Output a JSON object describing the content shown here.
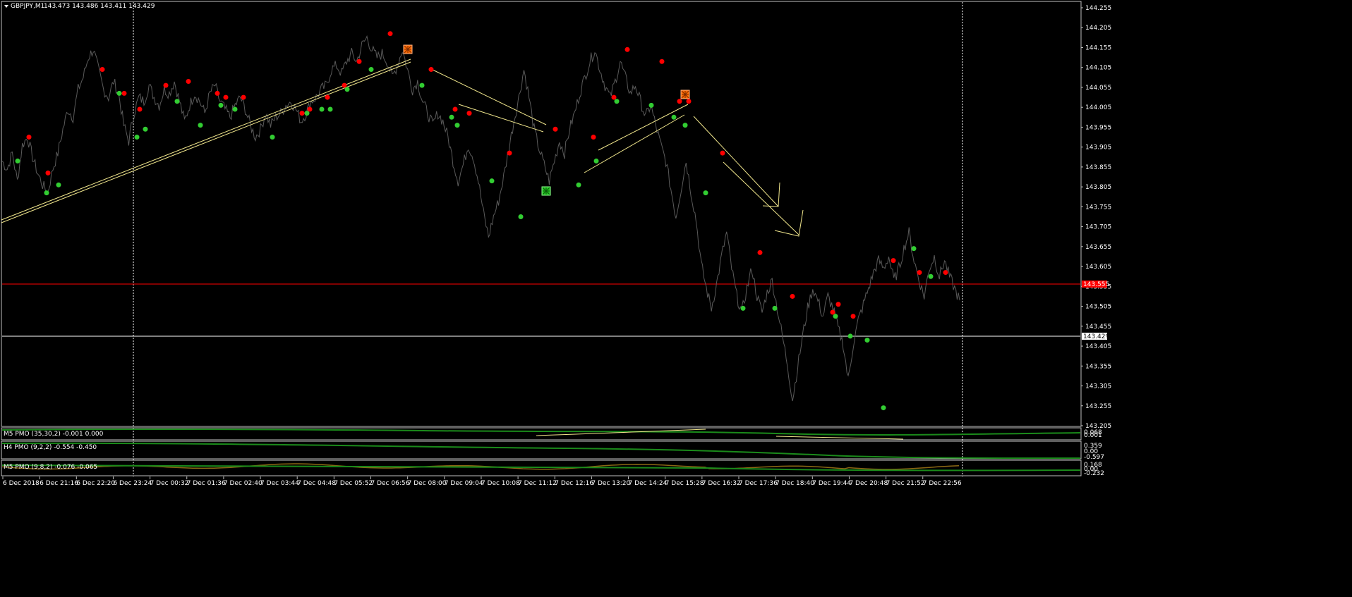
{
  "chart_header": {
    "symbol": "GBPJPY,M1",
    "ohlc": "143.473 143.486 143.411 143.429"
  },
  "chart_data": {
    "type": "line",
    "symbol": "GBPJPY",
    "timeframe": "M1",
    "price_axis": {
      "min": 143.205,
      "max": 144.255,
      "ticks": [
        "144.255",
        "144.205",
        "144.155",
        "144.105",
        "144.055",
        "144.005",
        "143.955",
        "143.905",
        "143.855",
        "143.805",
        "143.755",
        "143.705",
        "143.655",
        "143.605",
        "143.555",
        "143.505",
        "143.455",
        "143.405",
        "143.355",
        "143.305",
        "143.255",
        "143.205"
      ]
    },
    "time_axis": {
      "ticks": [
        "6 Dec 2018",
        "6 Dec 21:16",
        "6 Dec 22:20",
        "6 Dec 23:24",
        "7 Dec 00:32",
        "7 Dec 01:36",
        "7 Dec 02:40",
        "7 Dec 03:44",
        "7 Dec 04:48",
        "7 Dec 05:52",
        "7 Dec 06:56",
        "7 Dec 08:00",
        "7 Dec 09:04",
        "7 Dec 10:08",
        "7 Dec 11:12",
        "7 Dec 12:16",
        "7 Dec 13:20",
        "7 Dec 14:24",
        "7 Dec 15:28",
        "7 Dec 16:32",
        "7 Dec 17:36",
        "7 Dec 18:40",
        "7 Dec 19:44",
        "7 Dec 20:48",
        "7 Dec 21:52",
        "7 Dec 22:56"
      ]
    },
    "price_series": [
      [
        0,
        143.87
      ],
      [
        0.5,
        143.85
      ],
      [
        1,
        143.89
      ],
      [
        1.5,
        143.82
      ],
      [
        2,
        143.91
      ],
      [
        2.5,
        143.93
      ],
      [
        3,
        143.88
      ],
      [
        3.5,
        143.84
      ],
      [
        4,
        143.81
      ],
      [
        4.5,
        143.79
      ],
      [
        5,
        143.85
      ],
      [
        5.5,
        143.89
      ],
      [
        6,
        143.95
      ],
      [
        6.5,
        144.0
      ],
      [
        7,
        143.98
      ],
      [
        7.5,
        144.05
      ],
      [
        8,
        144.08
      ],
      [
        8.5,
        144.13
      ],
      [
        9,
        144.15
      ],
      [
        9.5,
        144.1
      ],
      [
        10,
        144.05
      ],
      [
        10.5,
        144.03
      ],
      [
        11,
        144.07
      ],
      [
        11.5,
        144.04
      ],
      [
        12,
        143.96
      ],
      [
        12.5,
        143.92
      ],
      [
        13,
        143.99
      ],
      [
        13.5,
        144.03
      ],
      [
        14,
        144.02
      ],
      [
        14.5,
        144.06
      ],
      [
        15,
        144.03
      ],
      [
        15.5,
        144.01
      ],
      [
        16,
        144.05
      ],
      [
        16.5,
        144.04
      ],
      [
        17,
        144.07
      ],
      [
        17.5,
        144.02
      ],
      [
        18,
        143.97
      ],
      [
        18.5,
        144.01
      ],
      [
        19,
        144.04
      ],
      [
        19.5,
        144.02
      ],
      [
        20,
        143.99
      ],
      [
        20.5,
        144.04
      ],
      [
        21,
        144.06
      ],
      [
        21.5,
        144.02
      ],
      [
        22,
        144.0
      ],
      [
        22.5,
        143.98
      ],
      [
        23,
        144.01
      ],
      [
        23.5,
        144.03
      ],
      [
        24,
        144.0
      ],
      [
        24.5,
        143.96
      ],
      [
        25,
        143.93
      ],
      [
        25.5,
        143.95
      ],
      [
        26,
        143.99
      ],
      [
        26.5,
        143.96
      ],
      [
        27,
        143.98
      ],
      [
        27.5,
        143.99
      ],
      [
        28,
        144.01
      ],
      [
        28.5,
        144.02
      ],
      [
        29,
        144.0
      ],
      [
        29.5,
        143.97
      ],
      [
        30,
        143.99
      ],
      [
        30.5,
        144.02
      ],
      [
        31,
        144.03
      ],
      [
        31.5,
        144.05
      ],
      [
        32,
        144.06
      ],
      [
        32.5,
        144.1
      ],
      [
        33,
        144.11
      ],
      [
        33.5,
        144.09
      ],
      [
        34,
        144.12
      ],
      [
        34.5,
        144.14
      ],
      [
        35,
        144.12
      ],
      [
        35.5,
        144.16
      ],
      [
        36,
        144.18
      ],
      [
        36.5,
        144.15
      ],
      [
        37,
        144.13
      ],
      [
        37.5,
        144.14
      ],
      [
        38,
        144.12
      ],
      [
        38.5,
        144.08
      ],
      [
        39,
        144.11
      ],
      [
        39.5,
        144.15
      ],
      [
        40,
        144.1
      ],
      [
        40.5,
        144.05
      ],
      [
        41,
        144.07
      ],
      [
        41.5,
        144.02
      ],
      [
        42,
        143.99
      ],
      [
        42.5,
        143.96
      ],
      [
        43,
        143.99
      ],
      [
        43.5,
        143.97
      ],
      [
        44,
        143.93
      ],
      [
        44.5,
        143.87
      ],
      [
        45,
        143.82
      ],
      [
        45.5,
        143.86
      ],
      [
        46,
        143.91
      ],
      [
        46.5,
        143.88
      ],
      [
        47,
        143.82
      ],
      [
        47.5,
        143.74
      ],
      [
        48,
        143.68
      ],
      [
        48.5,
        143.73
      ],
      [
        49,
        143.77
      ],
      [
        49.5,
        143.83
      ],
      [
        50,
        143.9
      ],
      [
        50.5,
        143.97
      ],
      [
        51,
        144.03
      ],
      [
        51.5,
        144.1
      ],
      [
        52,
        144.03
      ],
      [
        52.5,
        143.95
      ],
      [
        53,
        143.9
      ],
      [
        53.5,
        143.86
      ],
      [
        54,
        143.82
      ],
      [
        54.5,
        143.87
      ],
      [
        55,
        143.92
      ],
      [
        55.5,
        143.89
      ],
      [
        56,
        143.95
      ],
      [
        56.5,
        143.99
      ],
      [
        57,
        144.04
      ],
      [
        57.5,
        144.08
      ],
      [
        58,
        144.12
      ],
      [
        58.5,
        144.15
      ],
      [
        59,
        144.1
      ],
      [
        59.5,
        144.06
      ],
      [
        60,
        144.03
      ],
      [
        60.5,
        144.07
      ],
      [
        61,
        144.12
      ],
      [
        61.5,
        144.08
      ],
      [
        62,
        144.04
      ],
      [
        62.5,
        144.06
      ],
      [
        63,
        144.02
      ],
      [
        63.5,
        143.98
      ],
      [
        64,
        144.01
      ],
      [
        64.5,
        143.96
      ],
      [
        65,
        143.91
      ],
      [
        65.5,
        143.87
      ],
      [
        66,
        143.8
      ],
      [
        66.5,
        143.73
      ],
      [
        67,
        143.8
      ],
      [
        67.5,
        143.87
      ],
      [
        68,
        143.79
      ],
      [
        68.5,
        143.72
      ],
      [
        69,
        143.61
      ],
      [
        69.5,
        143.55
      ],
      [
        70,
        143.5
      ],
      [
        70.5,
        143.56
      ],
      [
        71,
        143.63
      ],
      [
        71.5,
        143.69
      ],
      [
        72,
        143.6
      ],
      [
        72.5,
        143.53
      ],
      [
        73,
        143.49
      ],
      [
        73.5,
        143.55
      ],
      [
        74,
        143.6
      ],
      [
        74.5,
        143.53
      ],
      [
        75,
        143.49
      ],
      [
        75.5,
        143.54
      ],
      [
        76,
        143.57
      ],
      [
        76.5,
        143.5
      ],
      [
        77,
        143.43
      ],
      [
        77.5,
        143.36
      ],
      [
        78,
        143.27
      ],
      [
        78.5,
        143.35
      ],
      [
        79,
        143.43
      ],
      [
        79.5,
        143.5
      ],
      [
        80,
        143.55
      ],
      [
        80.5,
        143.52
      ],
      [
        81,
        143.48
      ],
      [
        81.5,
        143.53
      ],
      [
        82,
        143.5
      ],
      [
        82.5,
        143.45
      ],
      [
        83,
        143.41
      ],
      [
        83.5,
        143.32
      ],
      [
        84,
        143.41
      ],
      [
        84.5,
        143.47
      ],
      [
        85,
        143.51
      ],
      [
        85.5,
        143.55
      ],
      [
        86,
        143.59
      ],
      [
        86.5,
        143.62
      ],
      [
        87,
        143.6
      ],
      [
        87.5,
        143.63
      ],
      [
        88,
        143.57
      ],
      [
        88.5,
        143.6
      ],
      [
        89,
        143.65
      ],
      [
        89.5,
        143.69
      ],
      [
        90,
        143.62
      ],
      [
        90.5,
        143.57
      ],
      [
        91,
        143.53
      ],
      [
        91.5,
        143.6
      ],
      [
        92,
        143.63
      ],
      [
        92.5,
        143.58
      ],
      [
        93,
        143.62
      ],
      [
        93.5,
        143.58
      ],
      [
        94,
        143.55
      ],
      [
        94.5,
        143.52
      ]
    ],
    "red_dots": [
      [
        41,
        143.93
      ],
      [
        68,
        143.84
      ],
      [
        145,
        144.1
      ],
      [
        176,
        144.04
      ],
      [
        198,
        144.0
      ],
      [
        235,
        144.06
      ],
      [
        267,
        144.07
      ],
      [
        308,
        144.04
      ],
      [
        320,
        144.03
      ],
      [
        345,
        144.03
      ],
      [
        428,
        143.99
      ],
      [
        439,
        144.0
      ],
      [
        464,
        144.03
      ],
      [
        488,
        144.06
      ],
      [
        509,
        144.12
      ],
      [
        553,
        144.19
      ],
      [
        611,
        144.1
      ],
      [
        645,
        144.0
      ],
      [
        665,
        143.99
      ],
      [
        722,
        143.89
      ],
      [
        787,
        143.95
      ],
      [
        841,
        143.93
      ],
      [
        870,
        144.03
      ],
      [
        889,
        144.15
      ],
      [
        938,
        144.12
      ],
      [
        963,
        144.02
      ],
      [
        976,
        144.02
      ],
      [
        1024,
        143.89
      ],
      [
        1077,
        143.64
      ],
      [
        1123,
        143.53
      ],
      [
        1180,
        143.49
      ],
      [
        1188,
        143.51
      ],
      [
        1209,
        143.48
      ],
      [
        1266,
        143.62
      ],
      [
        1303,
        143.59
      ],
      [
        1340,
        143.59
      ]
    ],
    "green_dots": [
      [
        25,
        143.87
      ],
      [
        66,
        143.79
      ],
      [
        83,
        143.81
      ],
      [
        169,
        144.04
      ],
      [
        194,
        143.93
      ],
      [
        206,
        143.95
      ],
      [
        251,
        144.02
      ],
      [
        284,
        143.96
      ],
      [
        313,
        144.01
      ],
      [
        333,
        144.0
      ],
      [
        386,
        143.93
      ],
      [
        435,
        143.99
      ],
      [
        456,
        144.0
      ],
      [
        468,
        144.0
      ],
      [
        492,
        144.05
      ],
      [
        526,
        144.1
      ],
      [
        598,
        144.06
      ],
      [
        640,
        143.98
      ],
      [
        648,
        143.96
      ],
      [
        697,
        143.82
      ],
      [
        738,
        143.73
      ],
      [
        820,
        143.81
      ],
      [
        845,
        143.87
      ],
      [
        874,
        144.02
      ],
      [
        923,
        144.01
      ],
      [
        955,
        143.98
      ],
      [
        971,
        143.96
      ],
      [
        1000,
        143.79
      ],
      [
        1053,
        143.5
      ],
      [
        1098,
        143.5
      ],
      [
        1184,
        143.48
      ],
      [
        1205,
        143.43
      ],
      [
        1229,
        143.42
      ],
      [
        1252,
        143.25
      ],
      [
        1295,
        143.65
      ],
      [
        1319,
        143.58
      ]
    ],
    "horizontal_lines": [
      {
        "price": 143.555,
        "color": "#ff0000",
        "label": "143.555"
      },
      {
        "price": 143.429,
        "color": "#ffffff",
        "label": "143.429"
      }
    ],
    "vertical_dashed_lines": [
      "6 Dec 23:24",
      "7 Dec 22:56"
    ],
    "signal_markers": [
      {
        "type": "sell",
        "color": "#ff6a00"
      },
      {
        "type": "sell",
        "color": "#ff6a00"
      },
      {
        "type": "buy",
        "color": "#1fbf1f"
      }
    ]
  },
  "price_labels": {
    "red": "143.555",
    "white": "143.429"
  },
  "indicators": [
    {
      "label": "M5 PMO (35,30,2) -0.001 0.000",
      "scale_top": "0.068",
      "scale_mid": "0.001",
      "scale_bot": "-0.061"
    },
    {
      "label": "H4 PMO (9,2,2) -0.554 -0.450",
      "scale_top": "0.359",
      "scale_mid": "0.00",
      "scale_bot": "-0.597"
    },
    {
      "label": "M5 PMO (9,8,2) -0.076 -0.065",
      "scale_top": "0.168",
      "scale_mid": "0.00",
      "scale_bot": "-0.232"
    }
  ],
  "colors": {
    "background": "#000000",
    "price_line": "#5a5a5a",
    "red_dot": "#ff0000",
    "green_dot": "#32cd32",
    "trendline": "#f0e68c",
    "axis_text": "#ffffff",
    "border": "#c0c0c0",
    "pmo_green": "#1a8a1a",
    "pmo_olive": "#8b6914"
  }
}
